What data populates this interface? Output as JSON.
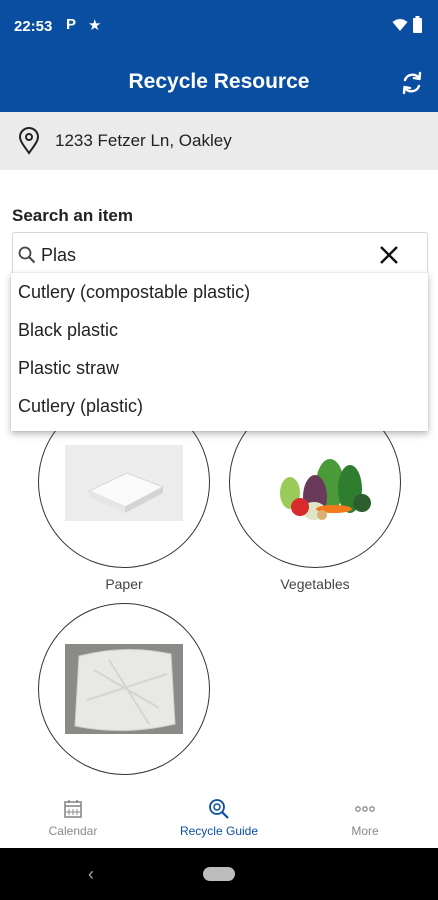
{
  "status_bar": {
    "time": "22:53",
    "icons": [
      "parking-icon",
      "star-icon",
      "wifi-icon",
      "battery-icon"
    ],
    "p_glyph": "P",
    "star_glyph": "★"
  },
  "app_bar": {
    "title": "Recycle Resource",
    "refresh_icon": "refresh-icon"
  },
  "address": {
    "icon": "location-pin-icon",
    "text": "1233 Fetzer Ln, Oakley"
  },
  "search": {
    "label": "Search an item",
    "value": "Plas",
    "clear_icon": "close-icon",
    "suggestions": [
      "Cutlery (compostable plastic)",
      "Black plastic",
      "Plastic straw",
      "Cutlery (plastic)"
    ]
  },
  "categories": [
    {
      "label": "Paper",
      "image": "paper-stack-image"
    },
    {
      "label": "Vegetables",
      "image": "vegetables-image"
    },
    {
      "label": "",
      "image": "plastic-bag-image"
    }
  ],
  "tabs": [
    {
      "label": "Calendar",
      "icon": "calendar-icon",
      "active": false
    },
    {
      "label": "Recycle Guide",
      "icon": "recycle-guide-icon",
      "active": true
    },
    {
      "label": "More",
      "icon": "more-icon",
      "active": false
    }
  ],
  "system_nav": {
    "back_glyph": "‹"
  },
  "colors": {
    "primary": "#0a4ea2",
    "address_bg": "#ebebeb",
    "tab_inactive": "#888888",
    "nav_bg": "#000000"
  }
}
